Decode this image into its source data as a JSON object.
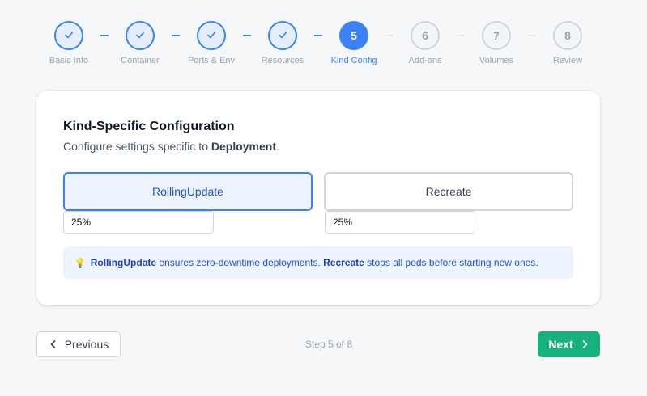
{
  "stepper": {
    "steps": [
      {
        "number": "1",
        "label": "Basic Info",
        "status": "done"
      },
      {
        "number": "2",
        "label": "Container",
        "status": "done"
      },
      {
        "number": "3",
        "label": "Ports & Env",
        "status": "done"
      },
      {
        "number": "4",
        "label": "Resources",
        "status": "done"
      },
      {
        "number": "5",
        "label": "Kind Config",
        "status": "active"
      },
      {
        "number": "6",
        "label": "Add-ons",
        "status": "todo"
      },
      {
        "number": "7",
        "label": "Volumes",
        "status": "todo"
      },
      {
        "number": "8",
        "label": "Review",
        "status": "todo"
      }
    ],
    "done_icon": "check-icon"
  },
  "card": {
    "title": "Kind-Specific Configuration",
    "subtitle_prefix": "Configure settings specific to ",
    "subtitle_kind": "Deployment",
    "subtitle_suffix": "."
  },
  "strategies": {
    "selected": "RollingUpdate",
    "options": [
      {
        "label": "RollingUpdate",
        "selected": true
      },
      {
        "label": "Recreate",
        "selected": false
      }
    ]
  },
  "inputs": {
    "max_surge_value": "25%",
    "max_unavailable_value": "25%"
  },
  "info": {
    "icon": "lightbulb-icon",
    "term1": "RollingUpdate",
    "text1": " ensures zero-downtime deployments. ",
    "term2": "Recreate",
    "text2": " stops all pods before starting new ones."
  },
  "footer": {
    "previous_label": "Previous",
    "next_label": "Next",
    "step_indicator": "Step 5 of 8"
  },
  "colors": {
    "accent": "#3b82f6",
    "success": "#16b17e",
    "muted": "#9ca3af"
  }
}
